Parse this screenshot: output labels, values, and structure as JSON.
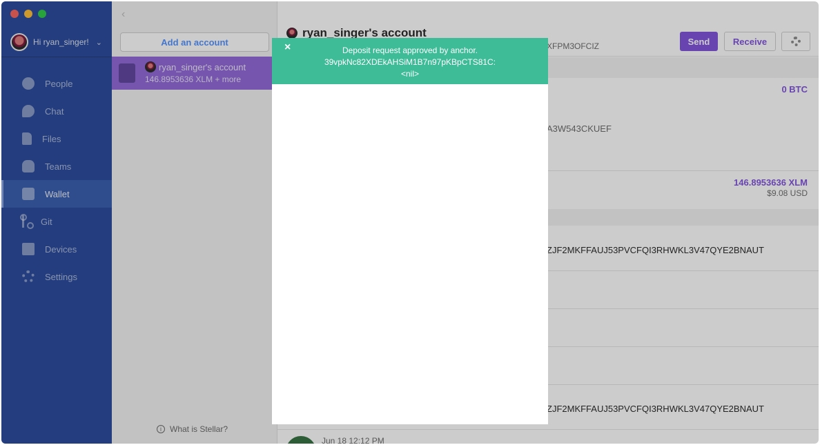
{
  "nav": {
    "greeting": "Hi ryan_singer!",
    "items": [
      {
        "label": "People",
        "icon": "people-icon"
      },
      {
        "label": "Chat",
        "icon": "chat-icon"
      },
      {
        "label": "Files",
        "icon": "files-icon"
      },
      {
        "label": "Teams",
        "icon": "teams-icon"
      },
      {
        "label": "Wallet",
        "icon": "wallet-icon",
        "active": true
      },
      {
        "label": "Git",
        "icon": "git-icon"
      },
      {
        "label": "Devices",
        "icon": "devices-icon"
      },
      {
        "label": "Settings",
        "icon": "settings-icon"
      }
    ]
  },
  "accounts": {
    "add_label": "Add an account",
    "selected": {
      "name": "ryan_singer's account",
      "balance": "146.8953636 XLM + more"
    },
    "help_link": "What is Stellar?"
  },
  "main": {
    "title": "ryan_singer's account",
    "address_partial": "XFPM3OFCIZ",
    "send_label": "Send",
    "receive_label": "Receive",
    "btc_balance": "0 BTC",
    "btc_issuer_partial": "A3W543CKUEF",
    "xlm_balance": "146.8953636 XLM",
    "xlm_usd": "$9.08 USD",
    "addr_row_1": "ZJF2MKFFAUJ53PVCFQI3RHWKL3V47QYE2BNAUT",
    "addr_row_2": "ZJF2MKFFAUJ53PVCFQI3RHWKL3V47QYE2BNAUT",
    "tx_time": "Jun 18 12:12 PM"
  },
  "modal": {
    "line1": "Deposit request approved by anchor.",
    "line2": "39vpkNc82XDEkAHSiM1B7n97pKBpCTS81C:",
    "line3": "<nil>",
    "close_label": "×"
  },
  "colors": {
    "nav_bg": "#22449a",
    "accent_purple": "#7c4ddc",
    "banner_green": "#3ebc97"
  }
}
